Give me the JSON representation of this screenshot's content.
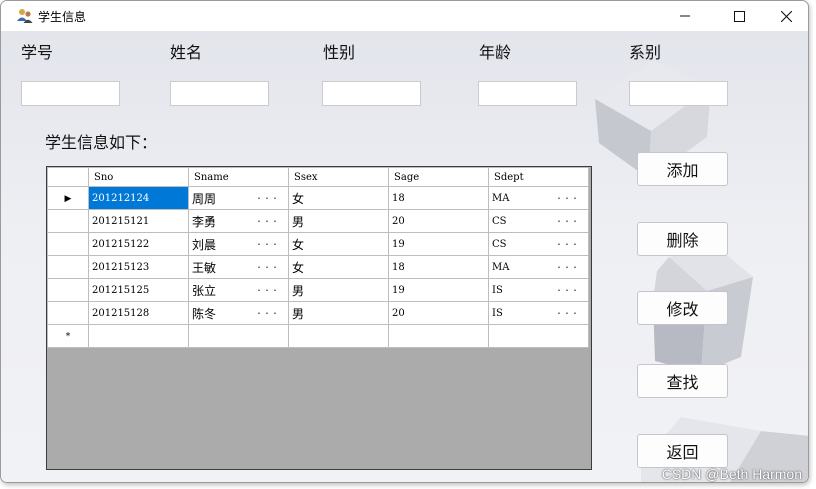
{
  "window": {
    "title": "学生信息",
    "icon": "app-people-icon",
    "controls": [
      "minimize-icon",
      "maximize-icon",
      "close-icon"
    ]
  },
  "form": {
    "labels": [
      "学号",
      "姓名",
      "性别",
      "年龄",
      "系别"
    ],
    "inputs": [
      "",
      "",
      "",
      "",
      ""
    ]
  },
  "caption": "学生信息如下：",
  "grid": {
    "columns": [
      "Sno",
      "Sname",
      "Ssex",
      "Sage",
      "Sdept"
    ],
    "rows": [
      [
        "201212124",
        "周周",
        "女",
        "18",
        "MA"
      ],
      [
        "201215121",
        "李勇",
        "男",
        "20",
        "CS"
      ],
      [
        "201215122",
        "刘晨",
        "女",
        "19",
        "CS"
      ],
      [
        "201215123",
        "王敏",
        "女",
        "18",
        "MA"
      ],
      [
        "201215125",
        "张立",
        "男",
        "19",
        "IS"
      ],
      [
        "201215128",
        "陈冬",
        "男",
        "20",
        "IS"
      ]
    ],
    "ellipsis": "...",
    "current_row_marker": "▶",
    "new_row_marker": "*",
    "selection_color": "#0078d7"
  },
  "buttons": {
    "add": "添加",
    "delete": "删除",
    "edit": "修改",
    "search": "查找",
    "back": "返回"
  },
  "watermark": "CSDN @Beth Harmon"
}
